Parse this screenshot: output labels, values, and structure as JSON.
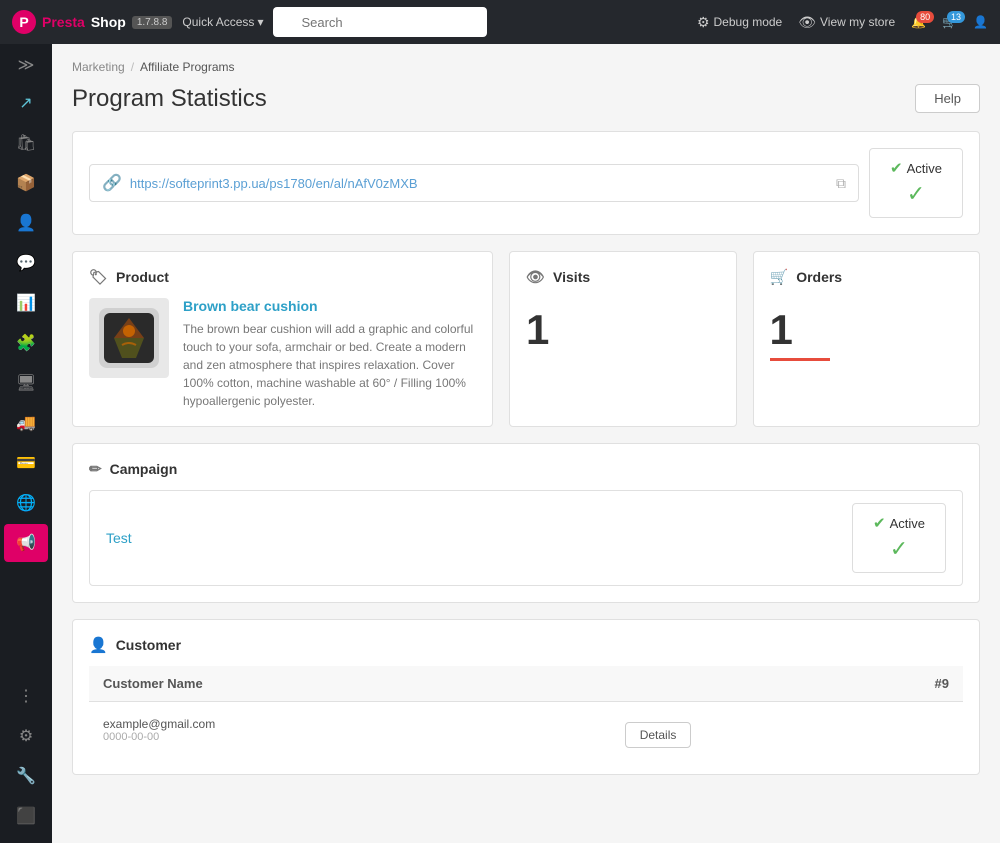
{
  "app": {
    "name": "PrestaShop",
    "version": "1.7.8.8"
  },
  "navbar": {
    "quick_access": "Quick Access",
    "search_placeholder": "Search",
    "debug_mode": "Debug mode",
    "view_store": "View my store",
    "notification_count": "80",
    "cart_count": "13"
  },
  "breadcrumb": {
    "parent": "Marketing",
    "current": "Affiliate Programs"
  },
  "page": {
    "title": "Program Statistics",
    "help_label": "Help"
  },
  "affiliate_link": {
    "url": "https://softeprint3.pp.ua/ps1780/en/al/nAfV0zMXB",
    "status_label": "Active",
    "status_check": "✓"
  },
  "product_section": {
    "title": "Product",
    "product_name": "Brown bear cushion",
    "product_desc": "The brown bear cushion will add a graphic and colorful touch to your sofa, armchair or bed. Create a modern and zen atmosphere that inspires relaxation. Cover 100% cotton, machine washable at 60° / Filling 100% hypoallergenic polyester."
  },
  "visits_section": {
    "title": "Visits",
    "count": "1"
  },
  "orders_section": {
    "title": "Orders",
    "count": "1"
  },
  "campaign_section": {
    "title": "Campaign",
    "campaign_name": "Test",
    "status_label": "Active",
    "status_check": "✓"
  },
  "customer_section": {
    "title": "Customer",
    "table_header_name": "Customer Name",
    "table_header_id": "#9",
    "email": "example@gmail.com",
    "date": "0000-00-00",
    "details_btn": "Details"
  },
  "sidebar": {
    "items": [
      {
        "icon": "≡",
        "name": "menu-toggle"
      },
      {
        "icon": "↗",
        "name": "dashboard"
      },
      {
        "icon": "🛍",
        "name": "orders"
      },
      {
        "icon": "📦",
        "name": "catalog"
      },
      {
        "icon": "👤",
        "name": "customers"
      },
      {
        "icon": "💬",
        "name": "messages"
      },
      {
        "icon": "📊",
        "name": "statistics"
      },
      {
        "icon": "🧩",
        "name": "modules"
      },
      {
        "icon": "🖥",
        "name": "design"
      },
      {
        "icon": "🚚",
        "name": "shipping"
      },
      {
        "icon": "💳",
        "name": "payment"
      },
      {
        "icon": "🌐",
        "name": "international"
      },
      {
        "icon": "📢",
        "name": "marketing"
      },
      {
        "icon": "⬇",
        "name": "more"
      },
      {
        "icon": "⚙",
        "name": "settings"
      },
      {
        "icon": "🔧",
        "name": "advanced"
      },
      {
        "icon": "⬛",
        "name": "logs"
      }
    ]
  }
}
